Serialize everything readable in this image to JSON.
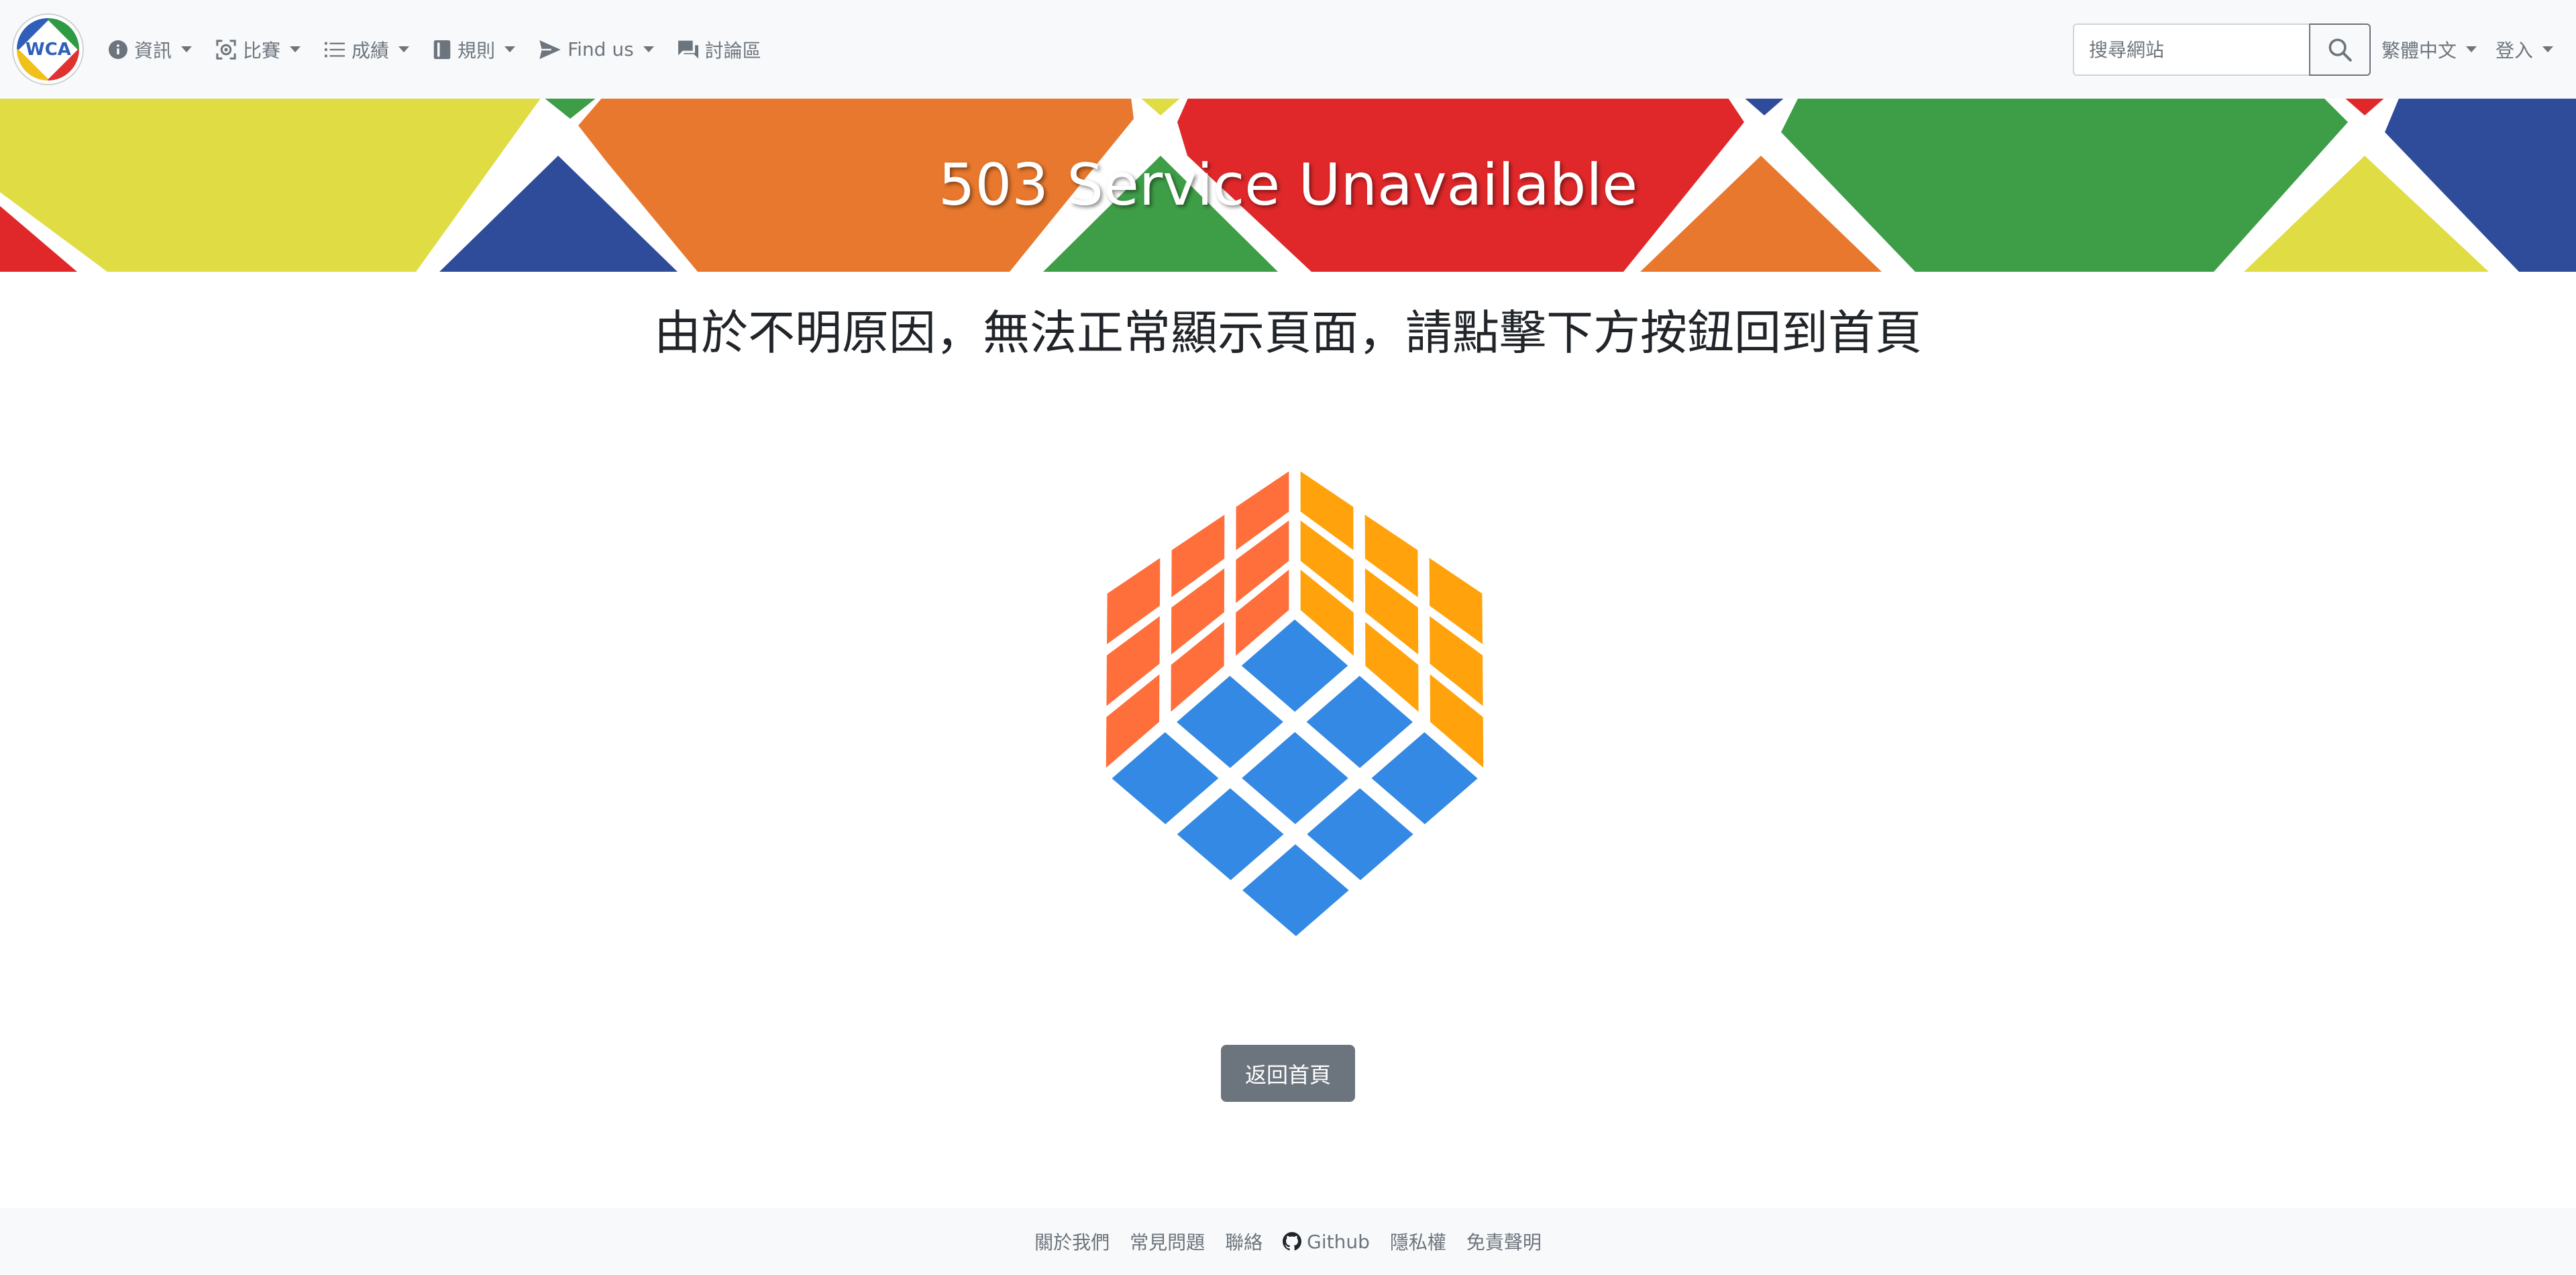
{
  "navbar": {
    "logo_text": "WCA",
    "menu": [
      {
        "label": "資訊",
        "icon": "info-circle-icon"
      },
      {
        "label": "比賽",
        "icon": "competition-icon"
      },
      {
        "label": "成績",
        "icon": "list-icon"
      },
      {
        "label": "規則",
        "icon": "book-icon"
      },
      {
        "label": "Find us",
        "icon": "send-icon"
      },
      {
        "label": "討論區",
        "icon": "forum-icon"
      }
    ],
    "search_placeholder": "搜尋網站",
    "search_icon": "magnifier-icon",
    "language": "繁體中文",
    "login": "登入"
  },
  "banner": {
    "title": "503 Service Unavailable",
    "colors": [
      "#e0dc44",
      "#e8782d",
      "#e0282a",
      "#3e9d47",
      "#2f4c9a"
    ]
  },
  "main": {
    "message": "由於不明原因，無法正常顯示頁面，請點擊下方按鈕回到首頁",
    "cube_colors": {
      "left": "#ff6f3c",
      "right": "#ffa20c",
      "top": "#3389e3"
    },
    "home_button": "返回首頁"
  },
  "footer": {
    "links": [
      {
        "label": "關於我們"
      },
      {
        "label": "常見問題"
      },
      {
        "label": "聯絡"
      },
      {
        "label": "Github",
        "icon": "github-icon"
      },
      {
        "label": "隱私權"
      },
      {
        "label": "免責聲明"
      }
    ]
  }
}
